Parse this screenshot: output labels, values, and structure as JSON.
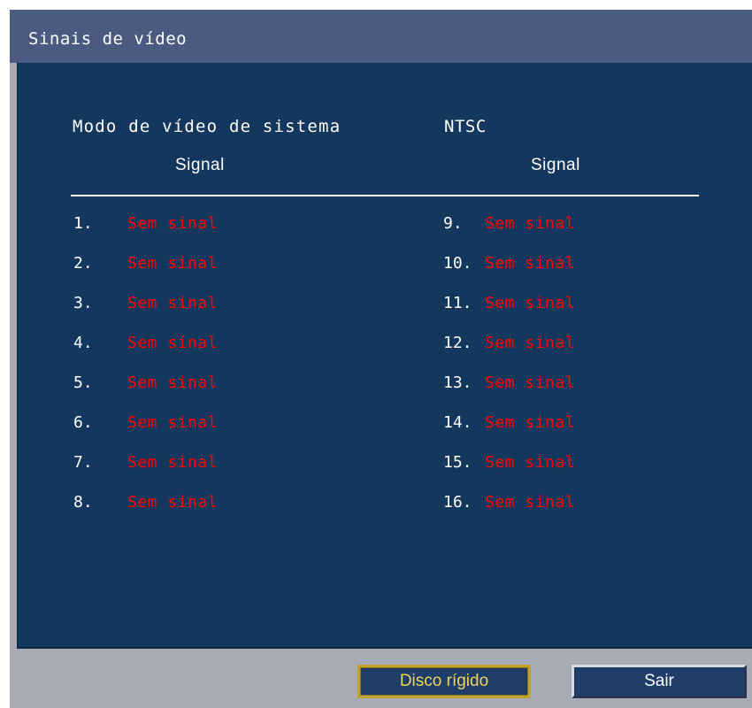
{
  "window": {
    "title": "Sinais de vídeo"
  },
  "header": {
    "mode_label": "Modo de vídeo de sistema",
    "mode_value": "NTSC",
    "col1_heading": "Signal",
    "col2_heading": "Signal"
  },
  "channels_left": [
    {
      "num": "1.",
      "status": "Sem sinal"
    },
    {
      "num": "2.",
      "status": "Sem sinal"
    },
    {
      "num": "3.",
      "status": "Sem sinal"
    },
    {
      "num": "4.",
      "status": "Sem sinal"
    },
    {
      "num": "5.",
      "status": "Sem sinal"
    },
    {
      "num": "6.",
      "status": "Sem sinal"
    },
    {
      "num": "7.",
      "status": "Sem sinal"
    },
    {
      "num": "8.",
      "status": "Sem sinal"
    }
  ],
  "channels_right": [
    {
      "num": "9.",
      "status": "Sem sinal"
    },
    {
      "num": "10.",
      "status": "Sem sinal"
    },
    {
      "num": "11.",
      "status": "Sem sinal"
    },
    {
      "num": "12.",
      "status": "Sem sinal"
    },
    {
      "num": "13.",
      "status": "Sem sinal"
    },
    {
      "num": "14.",
      "status": "Sem sinal"
    },
    {
      "num": "15.",
      "status": "Sem sinal"
    },
    {
      "num": "16.",
      "status": "Sem sinal"
    }
  ],
  "buttons": {
    "disk": "Disco rígido",
    "exit": "Sair"
  },
  "colors": {
    "panel_bg": "#13375d",
    "titlebar_bg": "#4b5a80",
    "frame_bg": "#a8abb6",
    "no_signal": "#ff0000",
    "focus_border": "#c0a32c"
  }
}
